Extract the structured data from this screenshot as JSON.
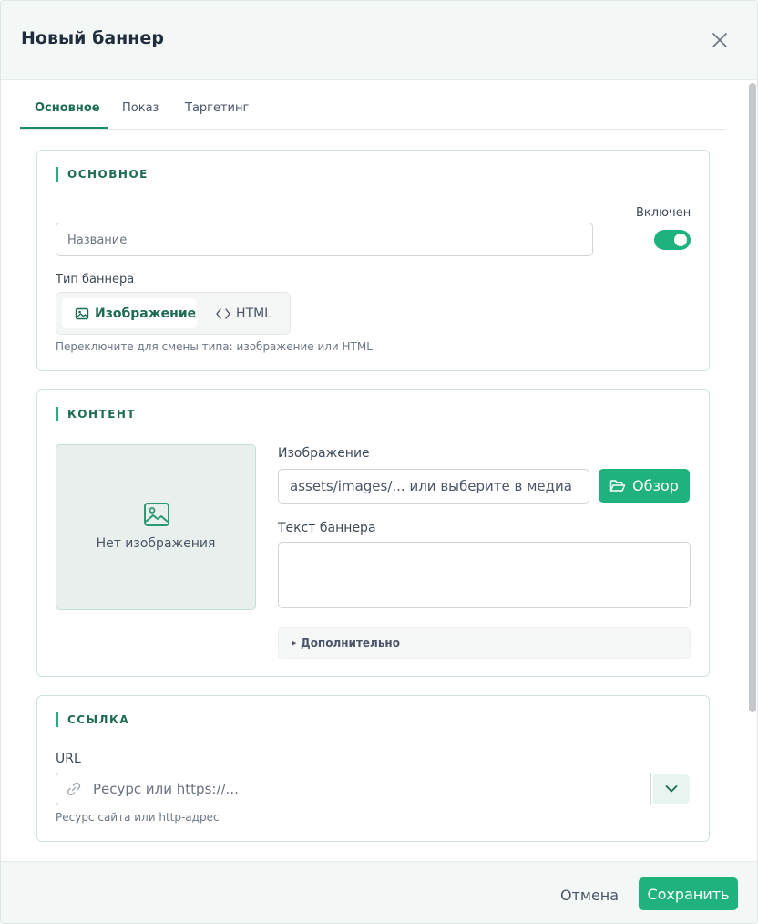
{
  "modal": {
    "title": "Новый баннер"
  },
  "tabs": [
    {
      "label": "Основное",
      "active": true
    },
    {
      "label": "Показ",
      "active": false
    },
    {
      "label": "Таргетинг",
      "active": false
    }
  ],
  "section_basic": {
    "title": "ОСНОВНОЕ",
    "name_placeholder": "Название",
    "enabled_label": "Включен",
    "enabled": true,
    "type_label": "Тип баннера",
    "type_options": [
      {
        "label": "Изображение",
        "icon": "image-icon",
        "selected": true
      },
      {
        "label": "HTML",
        "icon": "code-icon",
        "selected": false
      }
    ],
    "type_hint": "Переключите для смены типа: изображение или HTML"
  },
  "section_content": {
    "title": "КОНТЕНТ",
    "no_image": "Нет изображения",
    "image_label": "Изображение",
    "image_placeholder": "assets/images/... или выберите в медиа",
    "browse_button": "Обзор",
    "text_label": "Текст баннера",
    "text_value": "",
    "advanced_label": "Дополнительно"
  },
  "section_link": {
    "title": "ССЫЛКА",
    "url_label": "URL",
    "url_placeholder": "Ресурс или https://...",
    "url_hint": "Ресурс сайта или http-адрес"
  },
  "footer": {
    "cancel": "Отмена",
    "save": "Сохранить"
  },
  "colors": {
    "accent": "#1fb27d",
    "accent_dark": "#1d6b55",
    "header_bg": "#f3f8f6"
  }
}
